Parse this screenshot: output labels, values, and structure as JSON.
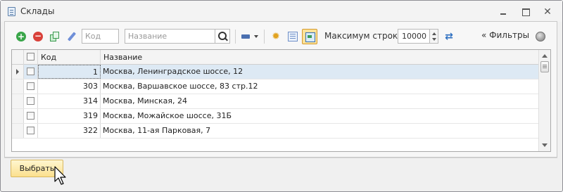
{
  "window": {
    "title": "Склады"
  },
  "toolbar": {
    "code_placeholder": "Код",
    "name_placeholder": "Название",
    "max_rows_label": "Максимум строк:",
    "max_rows_value": "10000",
    "filters_label": "Фильтры",
    "filters_glyph": "«"
  },
  "grid": {
    "columns": [
      "Код",
      "Название"
    ],
    "rows": [
      {
        "code": "1",
        "name": "Москва, Ленинградское шоссе, 12",
        "selected": true
      },
      {
        "code": "303",
        "name": "Москва, Варшавское шоссе, 83 стр.12",
        "selected": false
      },
      {
        "code": "314",
        "name": "Москва, Минская, 24",
        "selected": false
      },
      {
        "code": "319",
        "name": "Москва, Можайское шоссе, 31Б",
        "selected": false
      },
      {
        "code": "322",
        "name": "Москва, 11-ая Парковая, 7",
        "selected": false
      }
    ]
  },
  "footer": {
    "select_label": "Выбрать"
  },
  "colors": {
    "accent_button": "#fbe08e",
    "selected_row": "#dde9f4"
  },
  "icons": [
    "document-icon",
    "add-icon",
    "delete-icon",
    "copy-icon",
    "edit-icon",
    "search-icon",
    "print-icon",
    "highlight-icon",
    "table-icon",
    "fit-columns-icon",
    "refresh-icon",
    "filter-status-icon",
    "cursor-icon"
  ]
}
